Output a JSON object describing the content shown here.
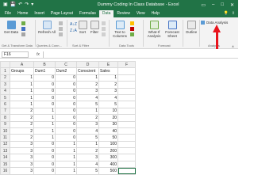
{
  "window": {
    "title": "Dummy Coding In Class Database - Excel"
  },
  "tabs": [
    {
      "label": "File"
    },
    {
      "label": "Home"
    },
    {
      "label": "Insert"
    },
    {
      "label": "Page Layout"
    },
    {
      "label": "Formulas"
    },
    {
      "label": "Data",
      "active": true
    },
    {
      "label": "Review"
    },
    {
      "label": "View"
    },
    {
      "label": "Help"
    }
  ],
  "ribbon": {
    "get_data": "Get Data",
    "refresh_all": "Refresh All",
    "sort": "Sort",
    "filter": "Filter",
    "text_to_columns": "Text to Columns",
    "what_if": "What-If Analysis",
    "forecast_sheet": "Forecast Sheet",
    "outline": "Outline",
    "data_analysis": "Data Analysis",
    "groups": {
      "get_transform": "Get & Transform Data",
      "queries": "Queries & Conn...",
      "sort_filter": "Sort & Filter",
      "data_tools": "Data Tools",
      "forecast": "Forecast",
      "analysis": "Analysis"
    }
  },
  "formula_bar": {
    "name_box": "F16",
    "fx_label": "fx",
    "content": ""
  },
  "colors": {
    "excel_green": "#217346",
    "arrow_red": "#e8141c"
  },
  "sheet": {
    "columns": [
      "A",
      "B",
      "C",
      "D",
      "E",
      "F"
    ],
    "rows": [
      {
        "n": "1",
        "cells": [
          "Groups",
          "Dum1",
          "Dum2",
          "Conscient",
          "Sales",
          ""
        ]
      },
      {
        "n": "2",
        "cells": [
          "1",
          "0",
          "0",
          "1",
          "1",
          ""
        ]
      },
      {
        "n": "3",
        "cells": [
          "1",
          "0",
          "0",
          "2",
          "2",
          ""
        ]
      },
      {
        "n": "4",
        "cells": [
          "1",
          "0",
          "0",
          "3",
          "3",
          ""
        ]
      },
      {
        "n": "5",
        "cells": [
          "1",
          "0",
          "0",
          "4",
          "4",
          ""
        ]
      },
      {
        "n": "6",
        "cells": [
          "1",
          "0",
          "0",
          "5",
          "5",
          ""
        ]
      },
      {
        "n": "7",
        "cells": [
          "2",
          "1",
          "0",
          "1",
          "10",
          ""
        ]
      },
      {
        "n": "8",
        "cells": [
          "2",
          "1",
          "0",
          "2",
          "20",
          ""
        ]
      },
      {
        "n": "9",
        "cells": [
          "2",
          "1",
          "0",
          "3",
          "30",
          ""
        ]
      },
      {
        "n": "10",
        "cells": [
          "2",
          "1",
          "0",
          "4",
          "40",
          ""
        ]
      },
      {
        "n": "11",
        "cells": [
          "2",
          "1",
          "0",
          "5",
          "50",
          ""
        ]
      },
      {
        "n": "12",
        "cells": [
          "3",
          "0",
          "1",
          "1",
          "100",
          ""
        ]
      },
      {
        "n": "13",
        "cells": [
          "3",
          "0",
          "1",
          "2",
          "200",
          ""
        ]
      },
      {
        "n": "14",
        "cells": [
          "3",
          "0",
          "1",
          "3",
          "300",
          ""
        ]
      },
      {
        "n": "15",
        "cells": [
          "3",
          "0",
          "1",
          "4",
          "400",
          ""
        ]
      },
      {
        "n": "16",
        "cells": [
          "3",
          "0",
          "1",
          "5",
          "500",
          ""
        ]
      }
    ]
  }
}
